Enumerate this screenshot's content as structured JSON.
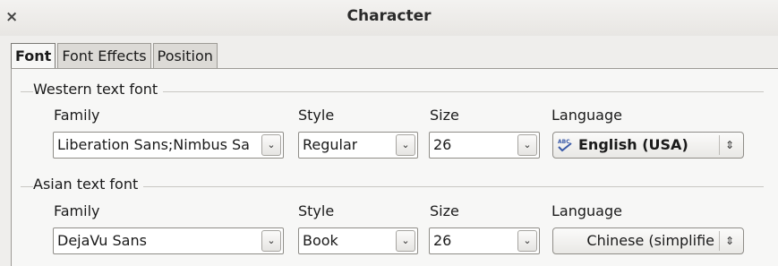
{
  "window": {
    "title": "Character",
    "close_glyph": "×"
  },
  "tabs": [
    {
      "label": "Font",
      "active": true
    },
    {
      "label": "Font Effects",
      "active": false
    },
    {
      "label": "Position",
      "active": false
    }
  ],
  "western": {
    "section_label": "Western text font",
    "family_label": "Family",
    "family_value": "Liberation Sans;Nimbus Sa",
    "style_label": "Style",
    "style_value": "Regular",
    "size_label": "Size",
    "size_value": "26",
    "language_label": "Language",
    "language_value": "English (USA)",
    "language_icon": "spellcheck-abc-icon"
  },
  "asian": {
    "section_label": "Asian text font",
    "family_label": "Family",
    "family_value": "DejaVu Sans",
    "style_label": "Style",
    "style_value": "Book",
    "size_label": "Size",
    "size_value": "26",
    "language_label": "Language",
    "language_value": "Chinese (simplifie"
  },
  "colors": {
    "window_bg": "#efeeec",
    "panel_bg": "#f7f7f6",
    "border": "#9d9b96"
  }
}
